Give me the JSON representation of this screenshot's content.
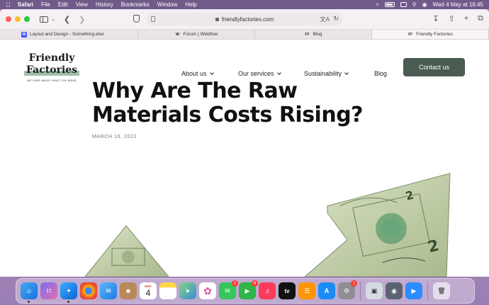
{
  "menubar": {
    "app_name": "Safari",
    "items": [
      "File",
      "Edit",
      "View",
      "History",
      "Bookmarks",
      "Window",
      "Help"
    ],
    "clock": "Wed 4 May at  16:45"
  },
  "browser": {
    "url": "friendlyfactories.com",
    "tabs": [
      {
        "favicon": "W",
        "label": "Layout and Design - Something else"
      },
      {
        "favicon": "W",
        "label": "Forum | Webflow"
      },
      {
        "favicon": "FF",
        "label": "Blog"
      },
      {
        "favicon": "FF",
        "label": "Friendly Factories"
      }
    ]
  },
  "site": {
    "logo": {
      "line1": "Friendly",
      "line2": "Factories",
      "tagline": "WE CARE ABOUT WHAT YOU WEAR"
    },
    "nav": {
      "about": "About us",
      "services": "Our services",
      "sustainability": "Sustainability",
      "blog": "Blog"
    },
    "cta": "Contact us",
    "post": {
      "title": "Why Are The Raw Materials Costs Rising?",
      "date": "MARCH 16, 2022"
    }
  },
  "dock": {
    "calendar_month": "MAY",
    "calendar_day": "4",
    "messages_badge": "1",
    "facetime_badge": "6",
    "settings_badge": "1",
    "tv_label": "tv"
  },
  "colors": {
    "cta_bg": "#4a5b51",
    "logo_highlight": "#9fbfa8",
    "money_green": "#b9c9a0"
  }
}
